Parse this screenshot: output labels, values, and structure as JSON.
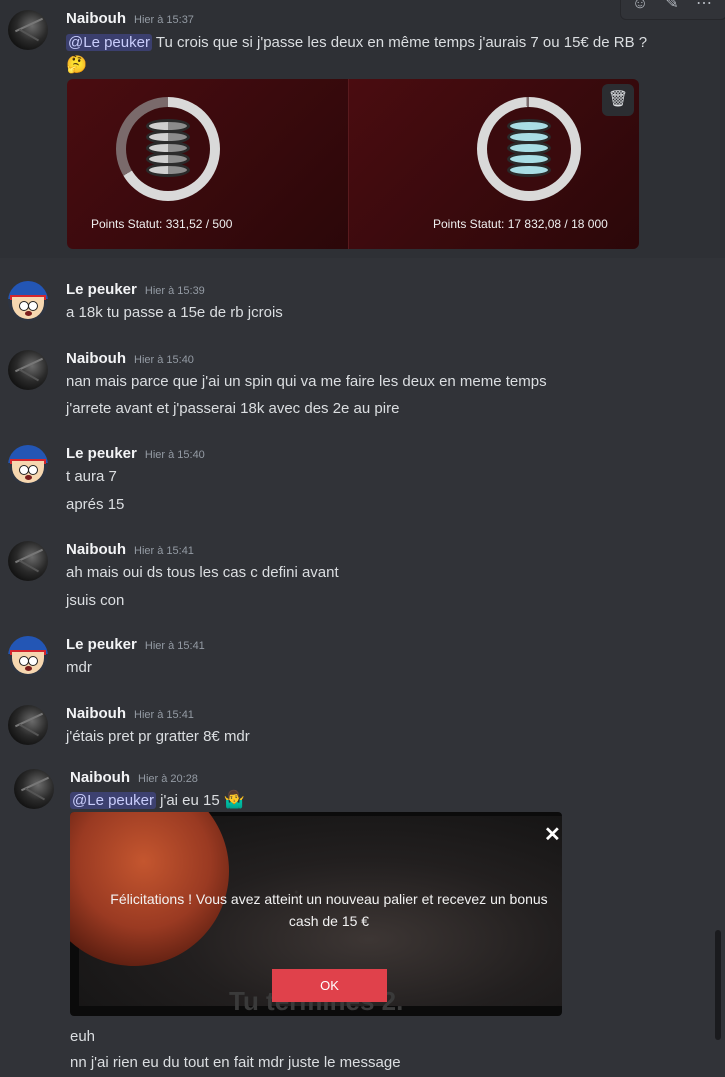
{
  "messages": [
    {
      "user": "Naibouh",
      "time": "Hier à 15:37",
      "mention": "@Le peuker",
      "text": "Tu crois que si j'passe les deux en même temps j'aurais 7 ou 15€ de RB ?",
      "emoji": "🤔"
    },
    {
      "user": "Le peuker",
      "time": "Hier à 15:39",
      "lines": [
        "a 18k tu passe a 15e de rb jcrois"
      ]
    },
    {
      "user": "Naibouh",
      "time": "Hier à 15:40",
      "lines": [
        "nan mais parce que j'ai un spin qui va me faire les deux en meme temps",
        "j'arrete avant et j'passerai 18k avec des 2e au pire"
      ]
    },
    {
      "user": "Le peuker",
      "time": "Hier à 15:40",
      "lines": [
        "t aura  7",
        "aprés 15"
      ]
    },
    {
      "user": "Naibouh",
      "time": "Hier à 15:41",
      "lines": [
        "ah mais oui ds tous les cas c defini avant",
        "jsuis con"
      ]
    },
    {
      "user": "Le peuker",
      "time": "Hier à 15:41",
      "lines": [
        "mdr"
      ]
    },
    {
      "user": "Naibouh",
      "time": "Hier à 15:41",
      "lines": [
        "j'étais pret pr gratter 8€ mdr"
      ]
    },
    {
      "user": "Naibouh",
      "time": "Hier à 20:28",
      "mention": "@Le peuker",
      "text": "j'ai eu 15",
      "emoji": "🤷‍♂️",
      "lines": [
        "euh",
        "nn j'ai rien eu du tout en fait mdr juste le message"
      ]
    }
  ],
  "attachment": {
    "left_label": "Points Statut: 331,52 / 500",
    "right_label": "Points Statut: 17 832,08 / 18 000",
    "left_progress": 0.663,
    "right_progress": 0.991
  },
  "popup": {
    "text": "Félicitations ! Vous avez atteint un nouveau palier et recevez un bonus cash de 15 €",
    "ok_label": "OK",
    "close_label": "✕",
    "bg_text": "Tu termines 2."
  },
  "toolbar": {
    "icons": [
      "smile-icon",
      "pencil-icon",
      "more-icon"
    ]
  },
  "colors": {
    "mention": "#c9cdfb",
    "ok_button": "#e0414b",
    "card_bg": "#4a0c10"
  }
}
